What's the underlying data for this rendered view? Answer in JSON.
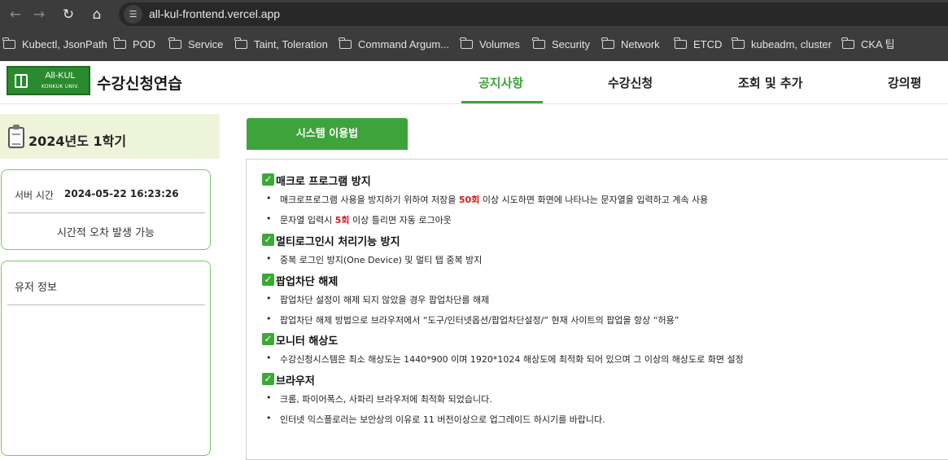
{
  "browser": {
    "url": "all-kul-frontend.vercel.app",
    "bookmarks": [
      "Kubectl, JsonPath",
      "POD",
      "Service",
      "Taint, Toleration",
      "Command Argum...",
      "Volumes",
      "Security",
      "Network",
      "ETCD",
      "kubeadm, cluster",
      "CKA 팁"
    ]
  },
  "header": {
    "logo_text": "All-KUL",
    "logo_sub": "KONKUK UNIV.",
    "title": "수강신청연습",
    "nav": [
      "공지사항",
      "수강신청",
      "조회 및 추가",
      "강의평"
    ],
    "active_nav": "공지사항"
  },
  "sidebar": {
    "semester": "2024년도 1학기",
    "server_label": "서버 시간",
    "server_time": "2024-05-22 16:23:26",
    "time_note": "시간적 오차 발생 가능",
    "user_title": "유저 정보"
  },
  "content": {
    "tab": "시스템 이용법",
    "sections": [
      {
        "title": "매크로 프로그램 방지",
        "items": [
          {
            "pre": "매크로프로그램 사용을 방지하기 위하여 저장을 ",
            "em": "50회",
            "post": " 이상 시도하면 화면에 나타나는 문자열을 입력하고 계속 사용"
          },
          {
            "pre": "문자열 입력시 ",
            "em": "5회",
            "post": " 이상 틀리면 자동 로그아웃"
          }
        ]
      },
      {
        "title": "멀티로그인시 처리기능 방지",
        "items": [
          {
            "pre": "중복 로그인 방지(One Device) 및 멀티 탭 중복 방지",
            "em": "",
            "post": ""
          }
        ]
      },
      {
        "title": "팝업차단 해제",
        "items": [
          {
            "pre": "팝업차단 설정이 해제 되지 않았을 경우 팝업차단를 해제",
            "em": "",
            "post": ""
          },
          {
            "pre": "팝업차단 해제 방법으로 브라우저에서 “도구/인터넷옵션/팝업차단설정/” 현재 사이트의 팝업을 항상 “허용”",
            "em": "",
            "post": ""
          }
        ]
      },
      {
        "title": "모니터 해상도",
        "items": [
          {
            "pre": "수강신청시스템은 최소 해상도는 1440*900 이며 1920*1024 해상도에 최적화 되어 있으며 그 이상의 해상도로 화면 설정",
            "em": "",
            "post": ""
          }
        ]
      },
      {
        "title": "브라우저",
        "items": [
          {
            "pre": "크롬, 파이어폭스, 사파리 브라우저에 최적화 되었습니다.",
            "em": "",
            "post": ""
          },
          {
            "pre": "인터넷 익스플로러는 보안상의 이유로 11 버전이상으로 업그레이드 하시기를 바랍니다.",
            "em": "",
            "post": ""
          }
        ]
      }
    ]
  }
}
